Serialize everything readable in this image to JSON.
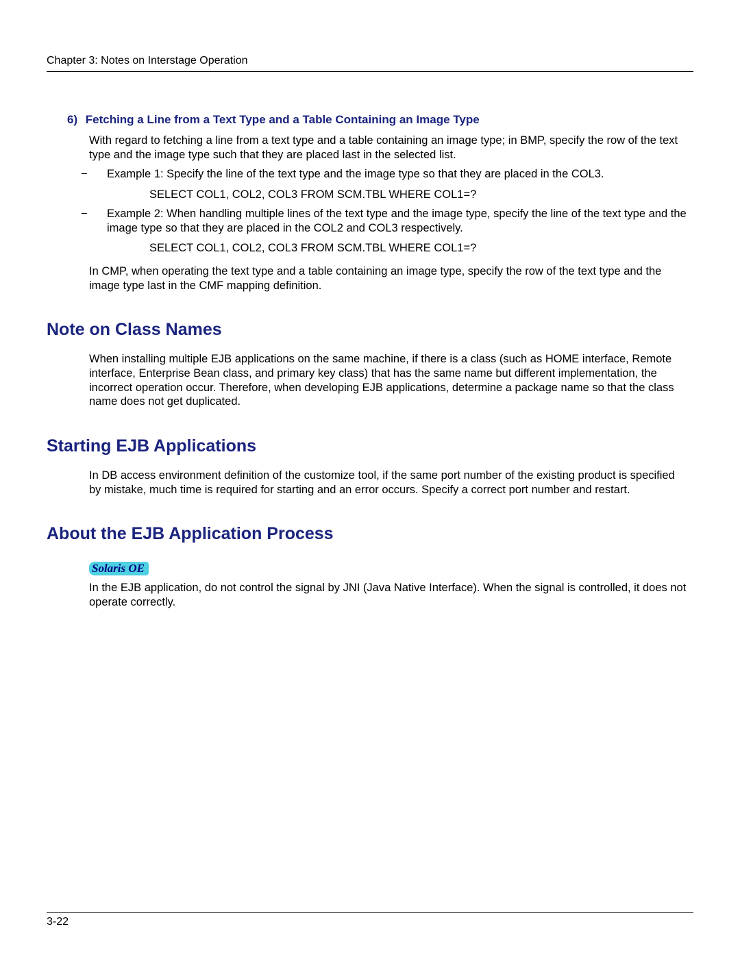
{
  "header": {
    "text": "Chapter 3:  Notes on Interstage Operation"
  },
  "sec6": {
    "num": "6)",
    "title": "Fetching a Line from a Text Type and a Table Containing an Image Type",
    "intro": "With regard to fetching a line from a text type and a table containing an image type; in BMP, specify the row of the text type and the image type such that they are placed last in the selected list.",
    "items": [
      {
        "text": "Example 1: Specify the line of the text type and the image type so that they are placed in the COL3.",
        "code": "SELECT COL1, COL2, COL3 FROM SCM.TBL WHERE COL1=?"
      },
      {
        "text": "Example 2: When handling multiple lines of the text type and the image type, specify the line of the text type and the image type so that they are placed in the COL2 and COL3 respectively.",
        "code": "SELECT COL1, COL2, COL3 FROM SCM.TBL WHERE COL1=?"
      }
    ],
    "outro": "In CMP, when operating the text type and a table containing an image type, specify the row of the text type and the image type last in the CMF mapping definition."
  },
  "note_class": {
    "heading": "Note on Class Names",
    "body": "When installing multiple EJB applications on the same machine, if there is a class (such as HOME interface, Remote interface, Enterprise Bean class, and primary key class) that has the same name but different implementation, the incorrect operation occur.  Therefore, when developing EJB applications, determine a package name so that the class name does not get duplicated."
  },
  "starting": {
    "heading": "Starting EJB Applications",
    "body": "In DB access environment definition of the customize tool, if the same port number of the existing product is specified by mistake, much time is required for starting and an error occurs. Specify a correct port number and restart."
  },
  "about": {
    "heading": "About the EJB Application Process",
    "badge": "Solaris OE",
    "body": "In the EJB application, do not control the signal by JNI (Java Native Interface). When the signal is controlled, it does not operate correctly."
  },
  "footer": {
    "page": "3-22"
  }
}
